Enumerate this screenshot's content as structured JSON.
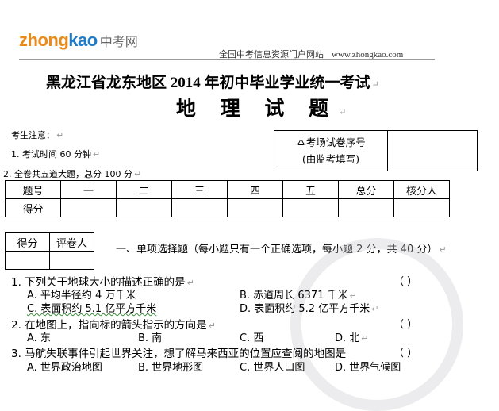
{
  "header": {
    "logo_part1": "zhong",
    "logo_part2": "kao",
    "logo_cn": "中考网",
    "portal_text": "全国中考信息资源门户网站",
    "portal_url": "www.zhongkao.com",
    "title_main": "黑龙江省龙东地区 2014 年初中毕业学业统一考试",
    "title_sub": "地 理 试 题"
  },
  "notes": {
    "heading": "考生注意：",
    "items": [
      "1. 考试时间 60 分钟",
      "2. 全卷共五道大题，总分 100 分"
    ]
  },
  "seat_box": {
    "label_line1": "本考场试卷序号",
    "label_line2": "(由监考填写)"
  },
  "score_table": {
    "header": [
      "题号",
      "一",
      "二",
      "三",
      "四",
      "五",
      "总分",
      "核分人"
    ],
    "row_label": "得分"
  },
  "grader_box": {
    "header": [
      "得分",
      "评卷人"
    ]
  },
  "section1": {
    "title": "一、单项选择题（每小题只有一个正确选项，每小题 2 分，共 40 分）"
  },
  "questions": [
    {
      "stem": "1. 下列关于地球大小的描述正确的是",
      "paren": "（        ）",
      "options": [
        "A. 平均半径约 4 万千米",
        "B. 赤道周长 6371 千米",
        "C. 表面积约 5.1 亿平方千米",
        "D. 表面积约 5.2 亿平方千米"
      ]
    },
    {
      "stem": "2. 在地图上，指向标的箭头指示的方向是",
      "paren": "（        ）",
      "options": [
        "A. 东",
        "B. 南",
        "C. 西",
        "D. 北"
      ]
    },
    {
      "stem": "3. 马航失联事件引起世界关注，想了解马来西亚的位置应查阅的地图是",
      "paren": "（        ）",
      "options": [
        "A. 世界政治地图",
        "B. 世界地形图",
        "C. 世界人口图",
        "D. 世界气候图"
      ]
    }
  ],
  "page_colors": {
    "logo_orange": "#e98a1c",
    "logo_blue": "#1f7bc7"
  }
}
